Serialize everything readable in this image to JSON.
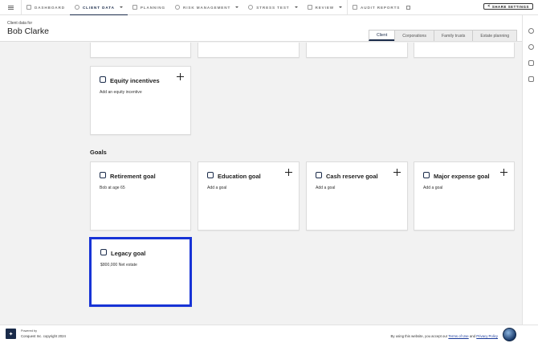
{
  "nav": {
    "items": [
      {
        "label": "DASHBOARD"
      },
      {
        "label": "CLIENT DATA"
      },
      {
        "label": "PLANNING"
      },
      {
        "label": "RISK MANAGEMENT"
      },
      {
        "label": "STRESS TEST"
      },
      {
        "label": "REVIEW"
      },
      {
        "label": "AUDIT REPORTS"
      }
    ],
    "share_label": "SHARE SETTINGS"
  },
  "header": {
    "client_for": "Client data for",
    "client_name": "Bob Clarke",
    "tabs": [
      "Client",
      "Corporations",
      "Family trusts",
      "Estate planning"
    ],
    "active_tab": "Client"
  },
  "cards": {
    "equity": {
      "title": "Equity incentives",
      "subtitle": "Add an equity incentive"
    }
  },
  "goals": {
    "section_title": "Goals",
    "retirement": {
      "title": "Retirement goal",
      "subtitle": "Bob at age 65"
    },
    "education": {
      "title": "Education goal",
      "subtitle": "Add a goal"
    },
    "cash_reserve": {
      "title": "Cash reserve goal",
      "subtitle": "Add a goal"
    },
    "major_expense": {
      "title": "Major expense goal",
      "subtitle": "Add a goal"
    },
    "legacy": {
      "title": "Legacy goal",
      "subtitle": "$800,000 Net estate"
    }
  },
  "footer": {
    "powered_by": "Powered by",
    "copyright": "Conquest Inc. copyright 2024",
    "terms_prefix": "By using this website, you accept our",
    "terms_link": "Terms of Use",
    "and": "and",
    "privacy_link": "Privacy Policy"
  },
  "colors": {
    "accent": "#1a2b4a",
    "selection": "#1733d6"
  }
}
